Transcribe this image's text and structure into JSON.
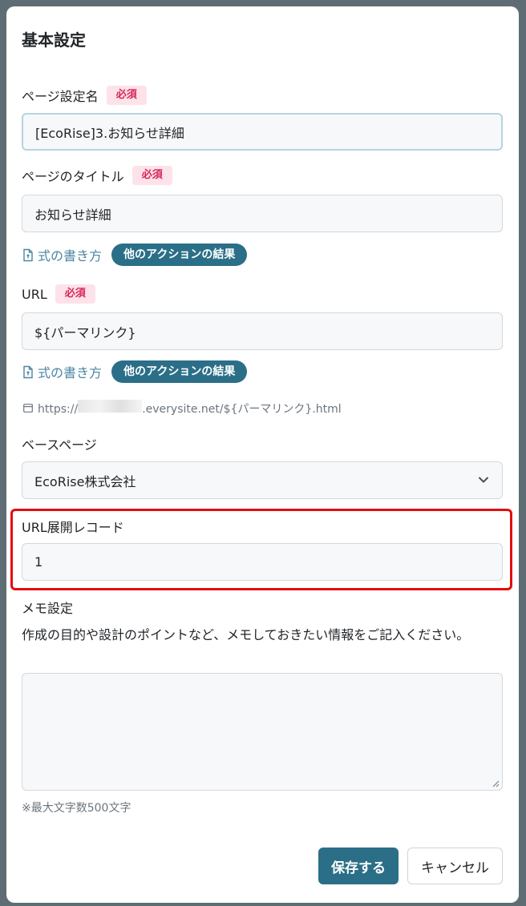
{
  "dialog": {
    "title": "基本設定"
  },
  "page_name": {
    "label": "ページ設定名",
    "badge": "必須",
    "value": "[EcoRise]3.お知らせ詳細"
  },
  "page_title": {
    "label": "ページのタイトル",
    "badge": "必須",
    "value": "お知らせ詳細",
    "formula_link": "式の書き方",
    "action_pill": "他のアクションの結果"
  },
  "url": {
    "label": "URL",
    "badge": "必須",
    "value": "${パーマリンク}",
    "formula_link": "式の書き方",
    "action_pill": "他のアクションの結果",
    "preview_prefix": "https://",
    "preview_suffix": ".everysite.net/${パーマリンク}.html"
  },
  "base_page": {
    "label": "ベースページ",
    "selected": "EcoRise株式会社"
  },
  "url_record": {
    "label": "URL展開レコード",
    "value": "1"
  },
  "memo": {
    "label": "メモ設定",
    "description": "作成の目的や設計のポイントなど、メモしておきたい情報をご記入ください。",
    "value": "",
    "limit_note": "※最大文字数500文字"
  },
  "actions": {
    "save": "保存する",
    "cancel": "キャンセル"
  },
  "colors": {
    "primary": "#2a6f87",
    "required_badge_bg": "#fde2ea",
    "required_badge_text": "#d6285a",
    "highlight_border": "#e30d0d"
  },
  "icons": [
    "file-formula-icon",
    "browser-window-icon",
    "chevron-down-icon",
    "resize-grip-icon"
  ]
}
